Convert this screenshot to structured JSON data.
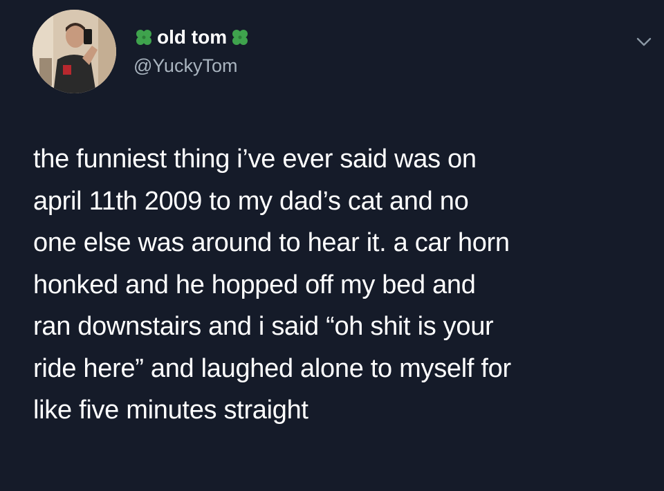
{
  "author": {
    "display_name": "old tom",
    "handle": "@YuckyTom",
    "avatar_icon": "profile-photo",
    "name_decoration_icon": "four-leaf-clover-icon",
    "clover_color": "#3fa34d"
  },
  "menu": {
    "icon": "chevron-down-icon"
  },
  "tweet": {
    "lines": [
      "the funniest thing i’ve ever said was on",
      "april 11th 2009 to my dad’s cat and no",
      "one else was around to hear it. a car horn",
      "honked and he hopped off my bed and",
      "ran downstairs and i said “oh shit is your",
      "ride here” and laughed alone to myself for",
      "like five minutes straight"
    ]
  },
  "colors": {
    "background": "#151b29",
    "text": "#ffffff",
    "secondary_text": "#a9b4bf"
  }
}
